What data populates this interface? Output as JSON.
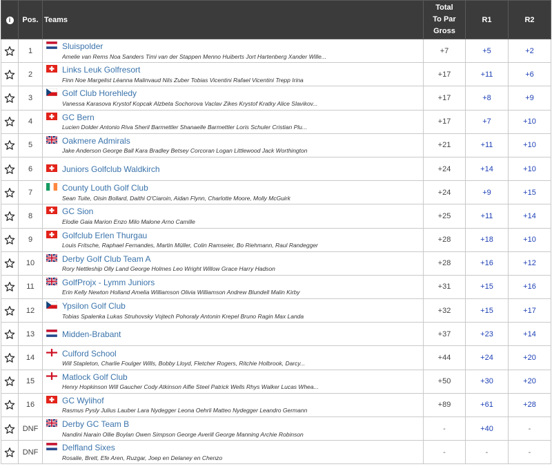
{
  "header": {
    "info": "i",
    "pos": "Pos.",
    "teams": "Teams",
    "total_line1": "Total",
    "total_line2": "To Par",
    "total_line3": "Gross",
    "r1": "R1",
    "r2": "R2"
  },
  "rows": [
    {
      "pos": "1",
      "flag": "nl",
      "team": "Sluispolder",
      "players": "Amelie van Rems Noa Sanders Timi van der Stappen Menno Huiberts Jort Hartenberg Xander Wille...",
      "total": "+7",
      "r1": "+5",
      "r2": "+2"
    },
    {
      "pos": "2",
      "flag": "ch",
      "team": "Links Leuk Golfresort",
      "players": "Finn Noe Margelist Léanna Malinvaud Nils Zuber Tobias Vicentini Rafael Vicentini Trepp Irina",
      "total": "+17",
      "r1": "+11",
      "r2": "+6"
    },
    {
      "pos": "3",
      "flag": "cz",
      "team": "Golf Club Horehledy",
      "players": "Vanessa Karasova Krystof Kopcak Alzbeta Sochorova Vaclav Zikes Krystof Kratky Alice Slavikov...",
      "total": "+17",
      "r1": "+8",
      "r2": "+9"
    },
    {
      "pos": "4",
      "flag": "ch",
      "team": "GC Bern",
      "players": "Lucien Dolder Antonio Riva Sheril Barmettler Shanaelle Barmettler Loris Schuler Cristian Plu...",
      "total": "+17",
      "r1": "+7",
      "r2": "+10"
    },
    {
      "pos": "5",
      "flag": "gb",
      "team": "Oakmere Admirals",
      "players": "Jake Anderson George Ball Kara Bradley Betsey Corcoran Logan Littlewood Jack Worthington",
      "total": "+21",
      "r1": "+11",
      "r2": "+10"
    },
    {
      "pos": "6",
      "flag": "ch",
      "team": "Juniors Golfclub Waldkirch",
      "players": "",
      "total": "+24",
      "r1": "+14",
      "r2": "+10"
    },
    {
      "pos": "7",
      "flag": "ie",
      "team": "County Louth Golf Club",
      "players": "Sean Tuite, Oisin Bollard, Daithi O'Ciaroin, Aidan Flynn, Charlotte Moore, Molly McGuirk",
      "total": "+24",
      "r1": "+9",
      "r2": "+15"
    },
    {
      "pos": "8",
      "flag": "ch",
      "team": "GC Sion",
      "players": "Elodie Gaia Marion Enzo Milo Malone Arno Camille",
      "total": "+25",
      "r1": "+11",
      "r2": "+14"
    },
    {
      "pos": "9",
      "flag": "ch",
      "team": "Golfclub Erlen Thurgau",
      "players": "Louis Fritsche, Raphael Fernandes, Martin Müller, Colin Ramseier, Bo Riehmann, Raul Randegger",
      "total": "+28",
      "r1": "+18",
      "r2": "+10"
    },
    {
      "pos": "10",
      "flag": "gb",
      "team": "Derby Golf Club Team A",
      "players": "Rory Nettleship Olly Land George Holmes Leo Wright Willow Grace Harry Hadson",
      "total": "+28",
      "r1": "+16",
      "r2": "+12"
    },
    {
      "pos": "11",
      "flag": "gb",
      "team": "GolfProjx - Lymm Juniors",
      "players": "Erin Kelly Newton Holland Amelia Williamson Olivia Williamson Andrew Blundell Malin Kirby",
      "total": "+31",
      "r1": "+15",
      "r2": "+16"
    },
    {
      "pos": "12",
      "flag": "cz",
      "team": "Ypsilon Golf Club",
      "players": "Tobias Spalenka Lukas Struhovsky Vojtech Pohoraly Antonin Krepel Bruno Ragin Max Landa",
      "total": "+32",
      "r1": "+15",
      "r2": "+17"
    },
    {
      "pos": "13",
      "flag": "nl",
      "team": "Midden-Brabant",
      "players": "",
      "total": "+37",
      "r1": "+23",
      "r2": "+14"
    },
    {
      "pos": "14",
      "flag": "en",
      "team": "Culford School",
      "players": "Will Stapleton, Charlie Foulger Wills, Bobby Lloyd, Fletcher Rogers, Ritchie Holbrook, Darcy...",
      "total": "+44",
      "r1": "+24",
      "r2": "+20"
    },
    {
      "pos": "15",
      "flag": "en",
      "team": "Matlock Golf Club",
      "players": "Henry Hopkinson Will Gaucher Cody Atkinson Alfie Steel Patrick Wells Rhys Walker Lucas Whea...",
      "total": "+50",
      "r1": "+30",
      "r2": "+20"
    },
    {
      "pos": "16",
      "flag": "ch",
      "team": "GC Wylihof",
      "players": "Rasmus Pysly Julius Lauber Lara Nydegger Leona Oehrli Matteo Nydegger Leandro Germann",
      "total": "+89",
      "r1": "+61",
      "r2": "+28"
    },
    {
      "pos": "DNF",
      "flag": "gb",
      "team": "Derby GC Team B",
      "players": "Nandini Narain Ollie Boylan Owen Simpson George Averill George Manning Archie Robinson",
      "total": "-",
      "r1": "+40",
      "r2": "-"
    },
    {
      "pos": "DNF",
      "flag": "nl",
      "team": "Delfland Sixes",
      "players": "Rosalie, Brett, Efe Aren, Ruzgar, Joep en Delaney en Chenzo",
      "total": "-",
      "r1": "-",
      "r2": "-"
    }
  ],
  "colors": {
    "header_bg": "#3b3b3b",
    "link": "#3a73ab",
    "round_score": "#1c3fb5",
    "border": "#c9c9c9"
  },
  "icons": {
    "favorite": "star-outline-icon",
    "info": "info-icon"
  }
}
